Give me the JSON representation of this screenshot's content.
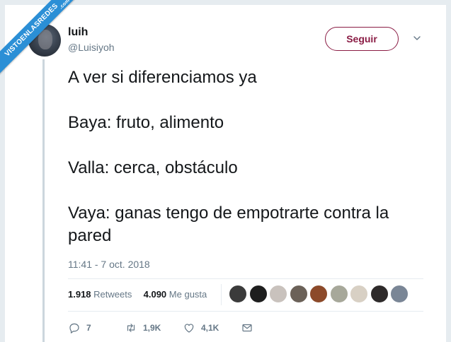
{
  "watermark": {
    "text": "VISTOENLASREDES",
    "suffix": ".com"
  },
  "user": {
    "name": "luih",
    "handle": "@Luisiyoh"
  },
  "follow_button": {
    "label": "Seguir"
  },
  "tweet": {
    "lines": [
      "A ver si diferenciamos ya",
      "Baya: fruto, alimento",
      "Valla: cerca, obstáculo",
      "Vaya: ganas tengo de empotrarte contra la pared"
    ],
    "timestamp": "11:41 - 7 oct. 2018"
  },
  "stats": {
    "retweets_count": "1.918",
    "retweets_label": "Retweets",
    "likes_count": "4.090",
    "likes_label": "Me gusta"
  },
  "likers": [
    {
      "color": "#3b3b3b"
    },
    {
      "color": "#1e1e1e"
    },
    {
      "color": "#c9c2bd"
    },
    {
      "color": "#6b6158"
    },
    {
      "color": "#8c4a2a"
    },
    {
      "color": "#a7a89a"
    },
    {
      "color": "#d8d0c4"
    },
    {
      "color": "#2e2a2a"
    },
    {
      "color": "#7a8696"
    }
  ],
  "actions": {
    "replies": "7",
    "retweets": "1,9K",
    "likes": "4,1K"
  },
  "colors": {
    "follow_accent": "#8a1c44",
    "muted": "#657786",
    "ribbon": "#2b8fd6"
  }
}
